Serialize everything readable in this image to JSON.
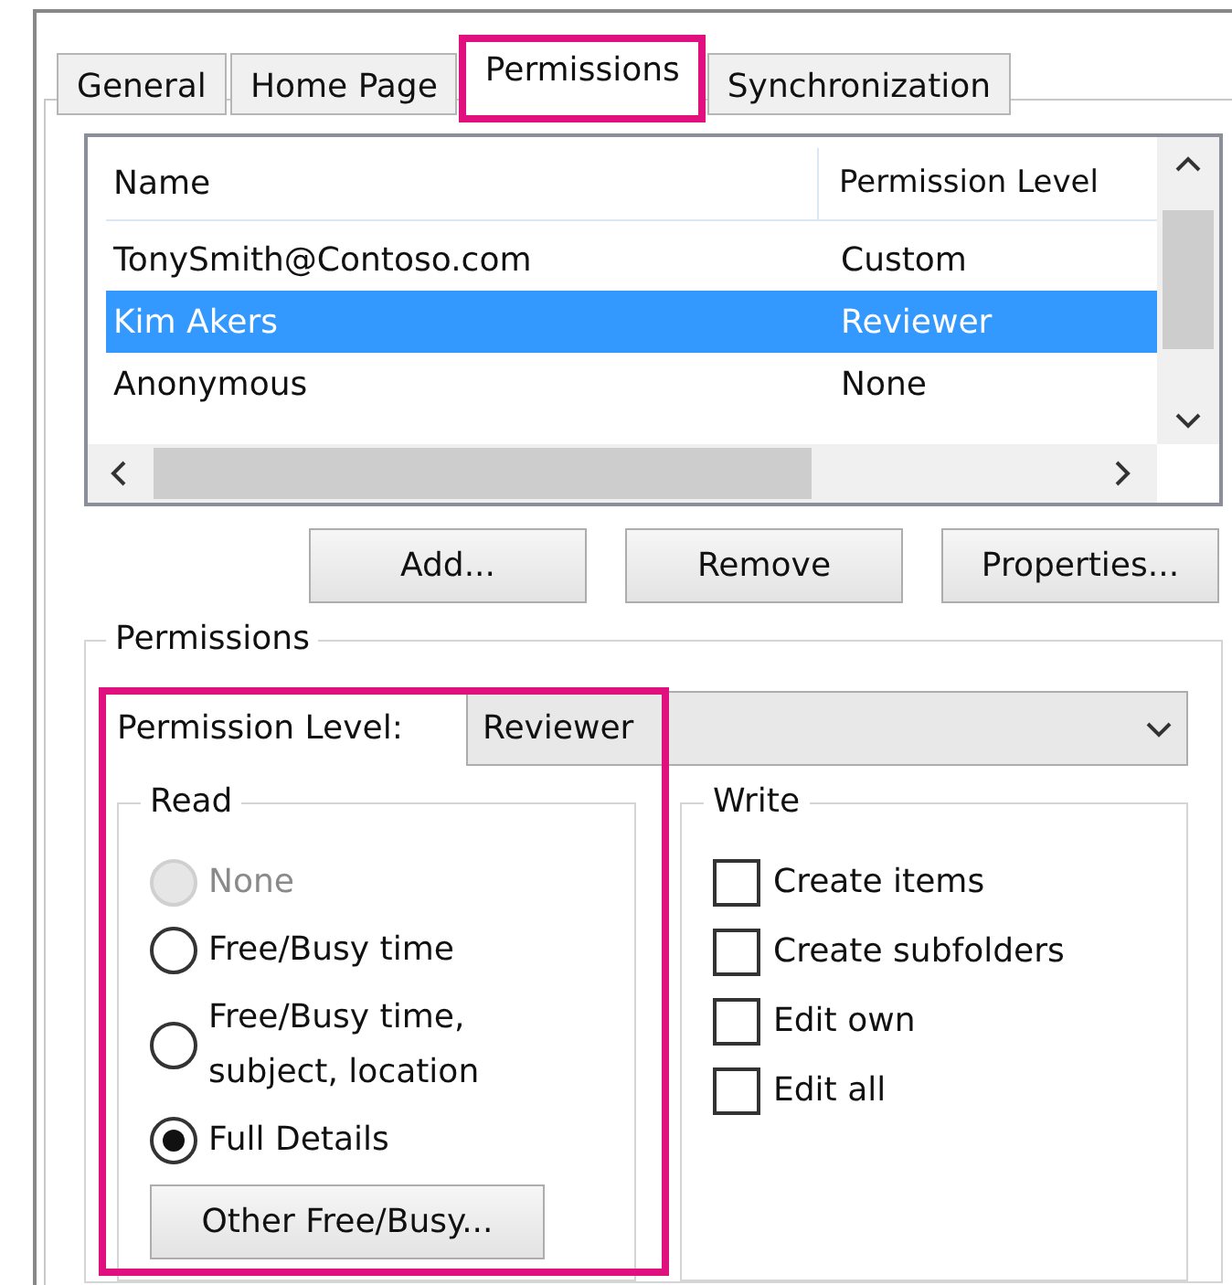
{
  "tabs": [
    {
      "label": "General",
      "selected": false,
      "highlighted": false
    },
    {
      "label": "Home Page",
      "selected": false,
      "highlighted": false
    },
    {
      "label": "Permissions",
      "selected": true,
      "highlighted": true
    },
    {
      "label": "Synchronization",
      "selected": false,
      "highlighted": false
    }
  ],
  "permissions_list": {
    "columns": [
      "Name",
      "Permission Level"
    ],
    "rows": [
      {
        "name": "TonySmith@Contoso.com",
        "permission_level": "Custom",
        "selected": false
      },
      {
        "name": "Kim Akers",
        "permission_level": "Reviewer",
        "selected": true
      },
      {
        "name": "Anonymous",
        "permission_level": "None",
        "selected": false
      }
    ]
  },
  "list_buttons": [
    "Add...",
    "Remove",
    "Properties..."
  ],
  "permissions_group": {
    "title": "Permissions",
    "highlighted": true,
    "permission_level": {
      "label": "Permission Level:",
      "value": "Reviewer"
    },
    "read": {
      "title": "Read",
      "options": [
        {
          "label": "None",
          "selected": false,
          "disabled": true
        },
        {
          "label": "Free/Busy time",
          "selected": false,
          "disabled": false
        },
        {
          "label": "Free/Busy time, subject, location",
          "selected": false,
          "disabled": false
        },
        {
          "label": "Full Details",
          "selected": true,
          "disabled": false
        }
      ],
      "button": "Other Free/Busy..."
    },
    "write": {
      "title": "Write",
      "options": [
        {
          "label": "Create items",
          "checked": false
        },
        {
          "label": "Create subfolders",
          "checked": false
        },
        {
          "label": "Edit own",
          "checked": false
        },
        {
          "label": "Edit all",
          "checked": false
        }
      ]
    }
  }
}
